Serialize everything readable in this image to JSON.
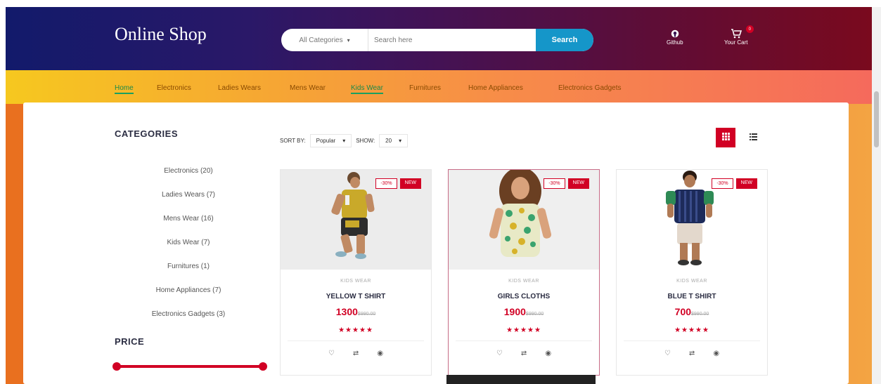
{
  "header": {
    "brand": "Online Shop",
    "search": {
      "category_value": "All Categories",
      "placeholder": "Search here",
      "button_label": "Search"
    },
    "github_label": "Github",
    "cart_label": "Your Cart",
    "cart_count": "0"
  },
  "nav": {
    "items": [
      "Home",
      "Electronics",
      "Ladies Wears",
      "Mens Wear",
      "Kids Wear",
      "Furnitures",
      "Home Appliances",
      "Electronics Gadgets"
    ]
  },
  "sidebar": {
    "categories_title": "CATEGORIES",
    "categories": [
      "Electronics (20)",
      "Ladies Wears (7)",
      "Mens Wear (16)",
      "Kids Wear (7)",
      "Furnitures (1)",
      "Home Appliances (7)",
      "Electronics Gadgets (3)"
    ],
    "price_title": "PRICE"
  },
  "toolbar": {
    "sort_label": "SORT BY:",
    "sort_value": "Popular",
    "show_label": "SHOW:",
    "show_value": "20"
  },
  "products": [
    {
      "category": "KIDS WEAR",
      "name": "YELLOW T SHIRT",
      "price": "1300",
      "old_price": "$990.00",
      "sale": "-30%",
      "badge": "NEW",
      "rating": "★★★★★"
    },
    {
      "category": "KIDS WEAR",
      "name": "GIRLS CLOTHS",
      "price": "1900",
      "old_price": "$990.00",
      "sale": "-30%",
      "badge": "NEW",
      "rating": "★★★★★"
    },
    {
      "category": "KIDS WEAR",
      "name": "BLUE T SHIRT",
      "price": "700",
      "old_price": "$990.00",
      "sale": "-30%",
      "badge": "NEW",
      "rating": "★★★★★"
    }
  ],
  "colors": {
    "accent": "#d10024",
    "search_button": "#1596c9",
    "header_start": "#121a6b",
    "header_end": "#7a0a1e"
  },
  "icons": {
    "github": "github-icon",
    "cart": "cart-icon",
    "grid_view": "grid-icon",
    "list_view": "list-icon",
    "wishlist": "heart-icon",
    "compare": "compare-icon",
    "quick_view": "eye-icon"
  }
}
